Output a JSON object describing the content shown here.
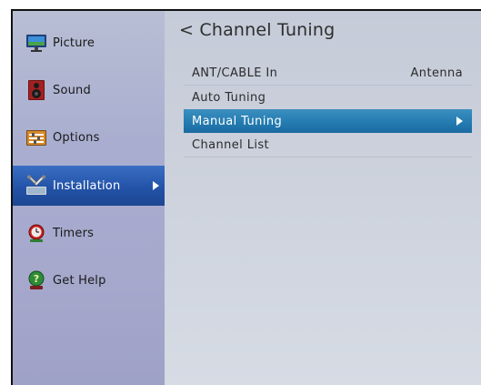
{
  "sidebar": {
    "items": [
      {
        "label": "Picture",
        "icon": "monitor-icon"
      },
      {
        "label": "Sound",
        "icon": "speaker-icon"
      },
      {
        "label": "Options",
        "icon": "options-icon"
      },
      {
        "label": "Installation",
        "icon": "tools-icon",
        "active": true
      },
      {
        "label": "Timers",
        "icon": "alarm-clock-icon"
      },
      {
        "label": "Get Help",
        "icon": "help-icon"
      }
    ]
  },
  "main": {
    "title": "Channel Tuning",
    "back_glyph": "<",
    "rows": [
      {
        "label": "ANT/CABLE In",
        "value": "Antenna"
      },
      {
        "label": "Auto Tuning"
      },
      {
        "label": "Manual Tuning",
        "selected": true
      },
      {
        "label": "Channel List"
      }
    ]
  },
  "colors": {
    "active_menu": "#2353a8",
    "selected_row": "#247cb1",
    "sidebar_bg": "#a9aed0",
    "content_bg": "#ccd1dc"
  }
}
